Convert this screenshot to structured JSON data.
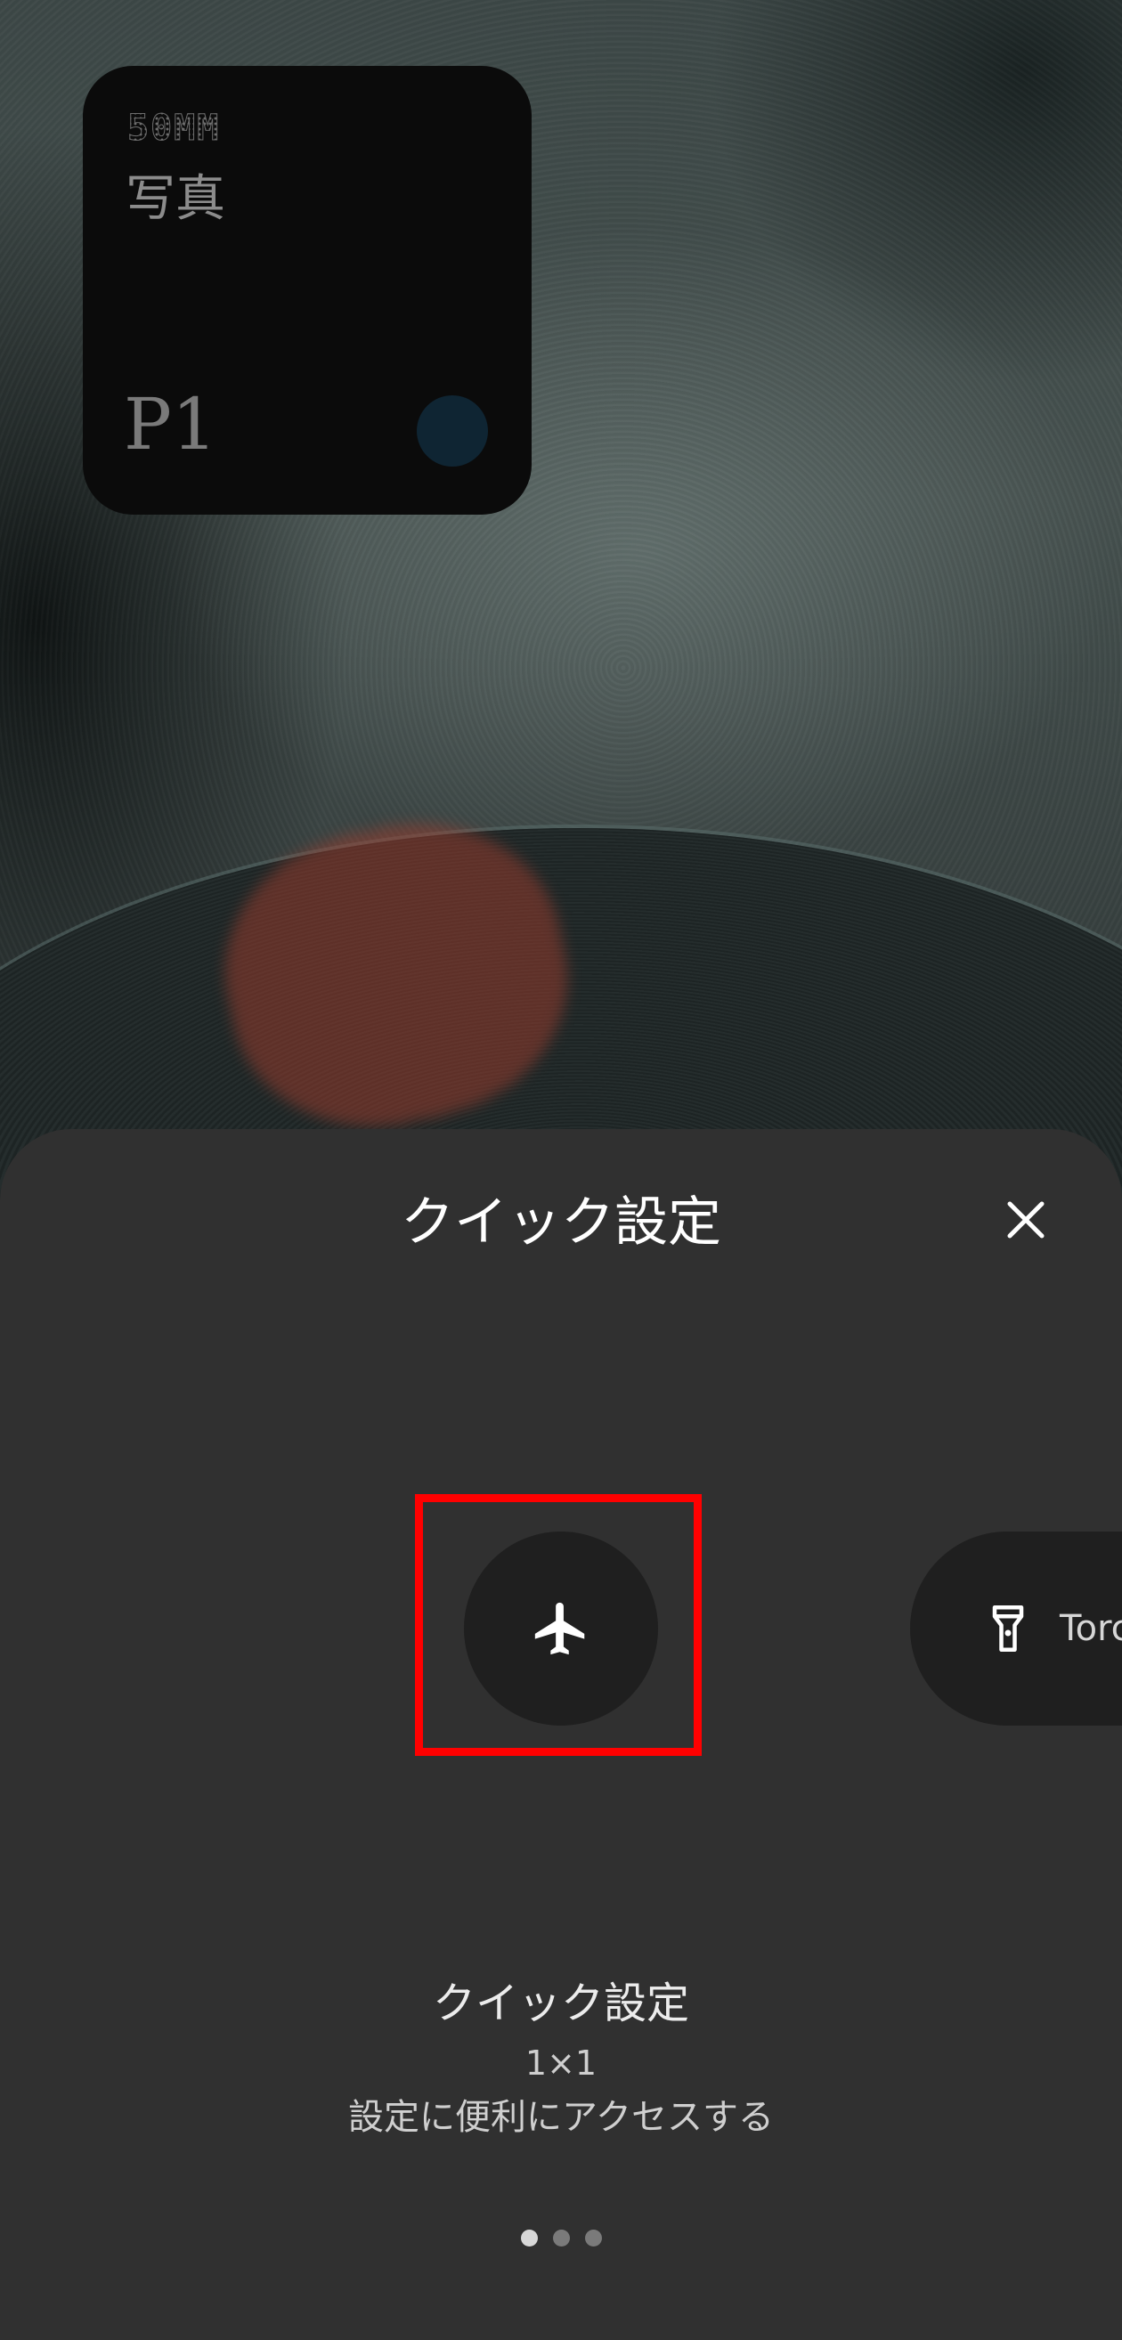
{
  "home_screen": {
    "photo_widget": {
      "logo": "50MM",
      "title": "写真",
      "page_label": "P1"
    }
  },
  "sheet": {
    "title": "クイック設定",
    "close_icon": "close-icon",
    "tiles": [
      {
        "icon": "airplane-icon",
        "label": "",
        "selected": true
      },
      {
        "icon": "flashlight-icon",
        "label": "Torc"
      }
    ],
    "widget_info": {
      "name": "クイック設定",
      "size": "1×1",
      "description": "設定に便利にアクセスする"
    },
    "pagination": {
      "count": 3,
      "active_index": 0
    }
  },
  "colors": {
    "sheet_background": "#303030",
    "tile_background": "#1f1f1f",
    "selection_frame": "#ff0000",
    "text_primary": "#ffffff"
  }
}
